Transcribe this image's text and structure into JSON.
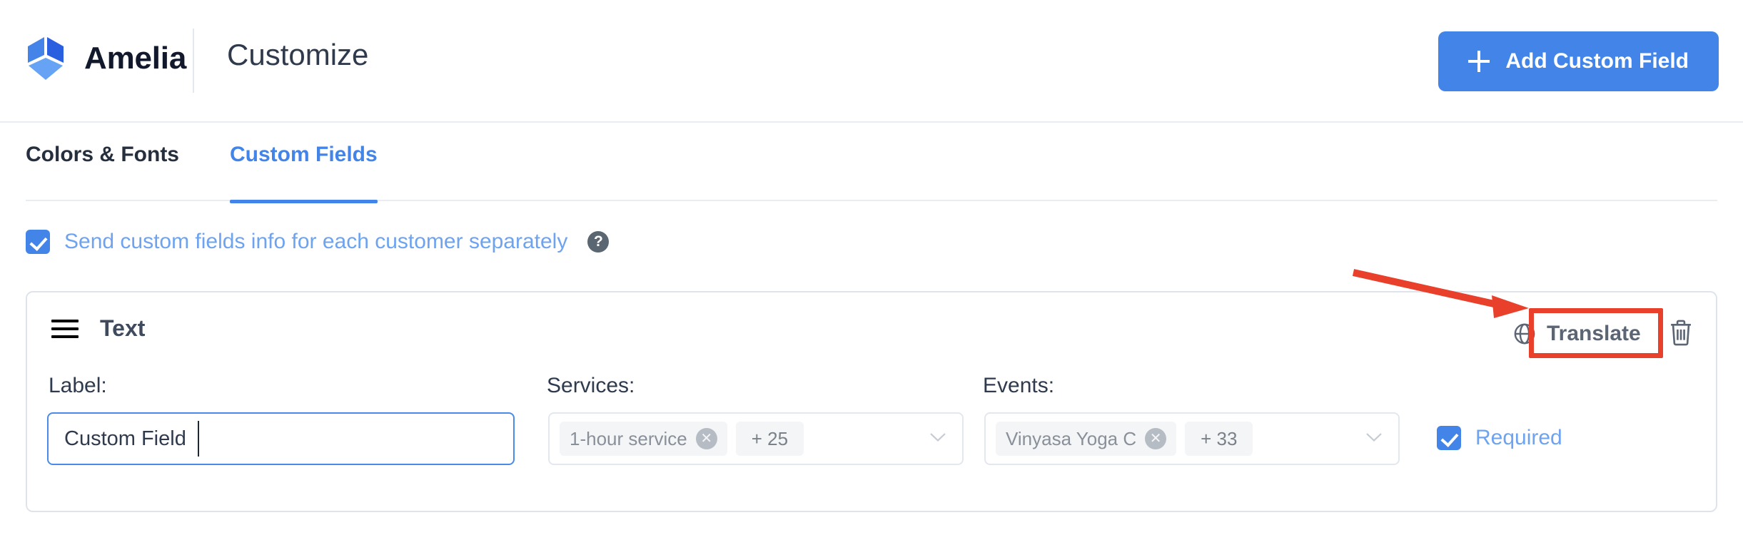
{
  "header": {
    "brand_name": "Amelia",
    "page_title": "Customize",
    "logo_icon": "amelia-cube-logo",
    "add_button_label": "Add Custom Field",
    "add_button_icon": "plus-icon",
    "accent_color": "#4384e8"
  },
  "tabs": [
    {
      "label": "Colors & Fonts",
      "active": false
    },
    {
      "label": "Custom Fields",
      "active": true
    }
  ],
  "send_info": {
    "label": "Send custom fields info for each customer separately",
    "checked": true,
    "help_icon": "question-mark-icon",
    "help_glyph": "?"
  },
  "field_card": {
    "drag_icon": "drag-handle-icon",
    "type_label": "Text",
    "translate": {
      "label": "Translate",
      "icon": "globe-icon"
    },
    "delete_icon": "trash-icon",
    "label_field": {
      "caption": "Label:",
      "value": "Custom Field",
      "placeholder": "Label",
      "focused": true
    },
    "services": {
      "caption": "Services:",
      "tags": [
        {
          "text": "1-hour service",
          "removable": true
        },
        {
          "text": "+ 25",
          "removable": false
        }
      ],
      "chevron_icon": "chevron-down-icon"
    },
    "events": {
      "caption": "Events:",
      "tags": [
        {
          "text": "Vinyasa Yoga C",
          "removable": true
        },
        {
          "text": "+ 33",
          "removable": false
        }
      ],
      "chevron_icon": "chevron-down-icon"
    },
    "required": {
      "label": "Required",
      "checked": true
    }
  },
  "annotations": {
    "highlight_color": "#e8402a",
    "arrow_icon": "red-arrow-pointing-to-translate",
    "box_target": "Translate"
  }
}
